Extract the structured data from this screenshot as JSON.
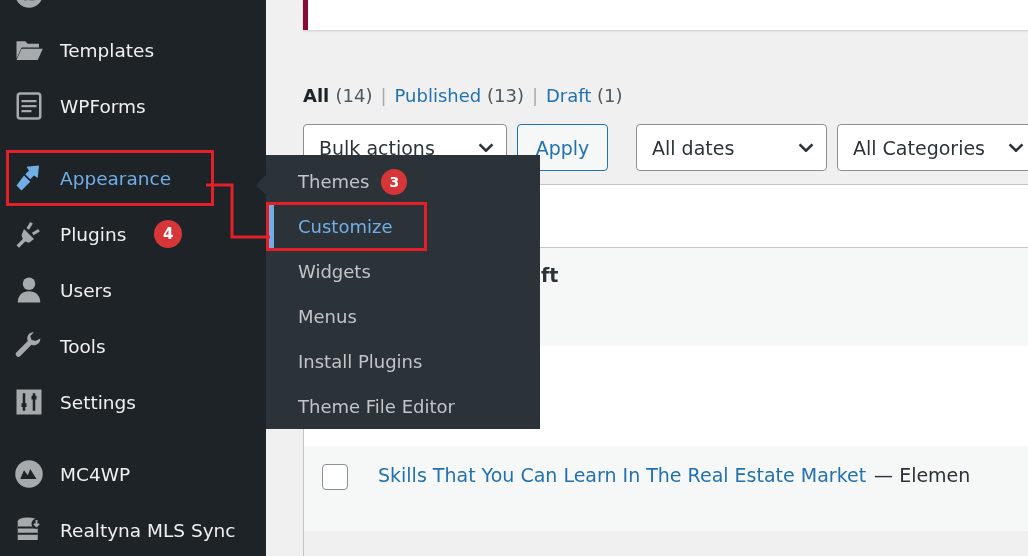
{
  "sidebar": {
    "groups": [
      [
        {
          "selected": false,
          "highlighted": false
        },
        {
          "label": "Templates",
          "selected": false,
          "highlighted": false
        },
        {
          "label": "WPForms",
          "selected": false,
          "highlighted": false
        }
      ],
      [
        {
          "label": "Appearance",
          "selected": true,
          "highlighted": true
        },
        {
          "label": "Plugins",
          "selected": false,
          "highlighted": false,
          "badge": "4"
        },
        {
          "label": "Users",
          "selected": false,
          "highlighted": false
        },
        {
          "label": "Tools",
          "selected": false,
          "highlighted": false
        },
        {
          "label": "Settings",
          "selected": false,
          "highlighted": false
        }
      ],
      [
        {
          "label": "MC4WP",
          "selected": false,
          "highlighted": false
        },
        {
          "label": "Realtyna MLS Sync",
          "selected": false,
          "highlighted": false
        }
      ]
    ]
  },
  "submenu": {
    "items": [
      {
        "label": "Themes",
        "selected": false,
        "highlighted": false,
        "badge": "3"
      },
      {
        "label": "Customize",
        "selected": true,
        "highlighted": true
      },
      {
        "label": "Widgets",
        "selected": false,
        "highlighted": false
      },
      {
        "label": "Menus",
        "selected": false,
        "highlighted": false
      },
      {
        "label": "Install Plugins",
        "selected": false,
        "highlighted": false
      },
      {
        "label": "Theme File Editor",
        "selected": false,
        "highlighted": false
      }
    ]
  },
  "filters": {
    "separator": "|",
    "items": [
      {
        "label": "All",
        "count": "(14)",
        "selected": true
      },
      {
        "label": "Published",
        "count": "(13)",
        "selected": false
      },
      {
        "label": "Draft",
        "count": "(1)",
        "selected": false
      }
    ]
  },
  "toolbar": {
    "bulk_actions": "Bulk actions",
    "apply": "Apply",
    "dates": "All dates",
    "categories": "All Categories"
  },
  "rows": [
    {
      "kind": "partial",
      "text": "ft"
    },
    {
      "kind": "blank"
    },
    {
      "kind": "post",
      "title": "Skills That You Can Learn In The Real Estate Market",
      "state": "— Elemen",
      "checked": false
    }
  ]
}
